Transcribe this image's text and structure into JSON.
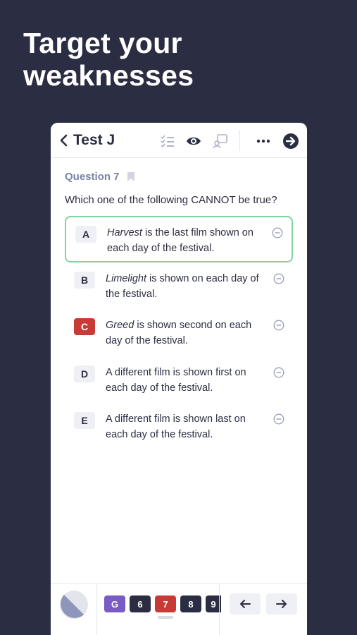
{
  "headline": {
    "line1": "Target your",
    "line2": "weaknesses"
  },
  "topbar": {
    "title": "Test J",
    "icons": [
      "chevron-left-icon",
      "checklist-icon",
      "eye-icon",
      "annotate-icon",
      "more-icon",
      "arrow-right-circle-icon"
    ]
  },
  "question": {
    "label": "Question 7",
    "prompt": "Which one of the following CANNOT be true?"
  },
  "choices": [
    {
      "letter": "A",
      "italic": "Harvest",
      "rest": " is the last film shown on each day of the festival.",
      "state": "selected"
    },
    {
      "letter": "B",
      "italic": "Limelight",
      "rest": " is shown on each day of the festival.",
      "state": "normal"
    },
    {
      "letter": "C",
      "italic": "Greed",
      "rest": " is shown second on each day of the festival.",
      "state": "incorrect"
    },
    {
      "letter": "D",
      "italic": "",
      "rest": "A different film is shown first on each day of the festival.",
      "state": "normal"
    },
    {
      "letter": "E",
      "italic": "",
      "rest": "A different film is shown last on each day of the festival.",
      "state": "normal"
    }
  ],
  "bottom": {
    "questions": [
      "G",
      "6",
      "7",
      "8",
      "9"
    ],
    "colors": {
      "accent_purple": "#7a5bc4",
      "incorrect_red": "#c83a35",
      "dark": "#2b2e42",
      "selected_green": "#7fd3a1"
    }
  }
}
